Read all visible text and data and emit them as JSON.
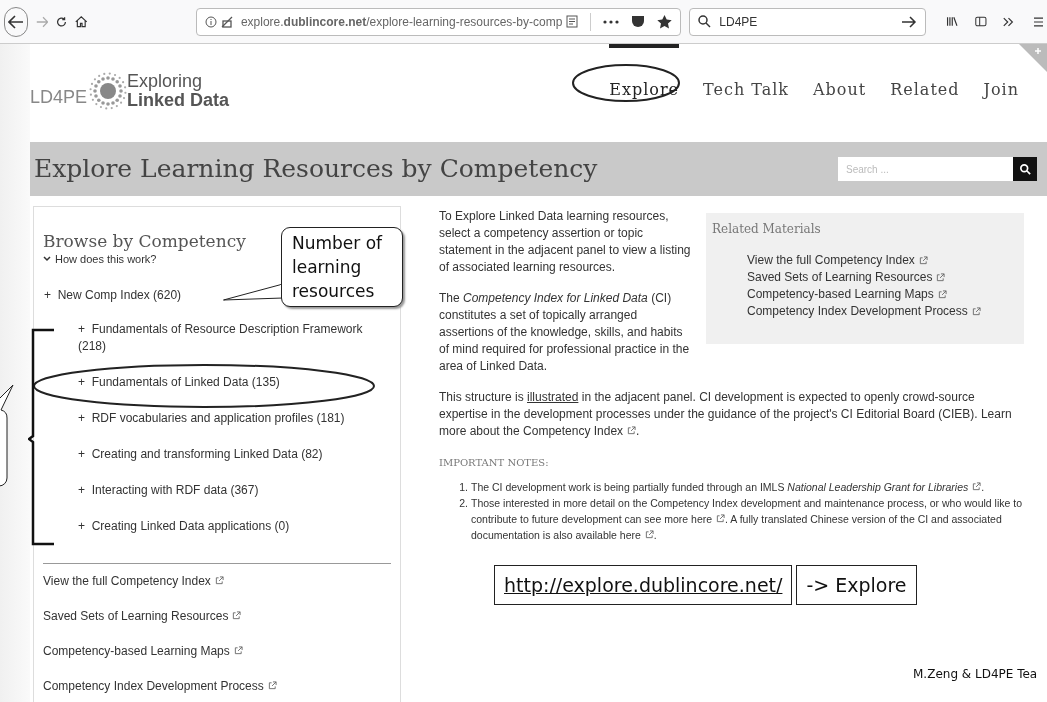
{
  "browser": {
    "url": "explore.**dublincore.net**/explore-learning-resources-by-comp",
    "search": "LD4PE"
  },
  "site": {
    "logo": "LD4PE",
    "brand": [
      "Exploring",
      "Linked Data"
    ],
    "nav": [
      {
        "label": "Explore",
        "selected": true
      },
      {
        "label": "Tech Talk",
        "selected": false
      },
      {
        "label": "About",
        "selected": false
      },
      {
        "label": "Related",
        "selected": false
      },
      {
        "label": "Join",
        "selected": false
      }
    ]
  },
  "page_title": "Explore Learning Resources by Competency",
  "search": {
    "placeholder": "Search ..."
  },
  "sidebar": {
    "heading": "Browse by Competency",
    "help": "How does this work?",
    "tree": [
      {
        "marker": "+",
        "label": "New Comp Index (620)",
        "children": [
          {
            "marker": "+",
            "label": "Fundamentals of Resource Description Framework (218)"
          },
          {
            "marker": "+",
            "label": "Fundamentals of Linked Data (135)"
          },
          {
            "marker": "+",
            "label": "RDF vocabularies and application profiles (181)"
          },
          {
            "marker": "+",
            "label": "Creating and transforming Linked Data (82)"
          },
          {
            "marker": "+",
            "label": "Interacting with RDF data (367)"
          },
          {
            "marker": "+",
            "label": "Creating Linked Data applications (0)"
          }
        ]
      }
    ],
    "links": [
      "View the full Competency Index",
      "Saved Sets of Learning Resources",
      "Competency-based Learning Maps",
      "Competency Index Development Process"
    ]
  },
  "related": {
    "heading": "Related Materials",
    "links": [
      "View the full Competency Index",
      "Saved Sets of Learning Resources",
      "Competency-based Learning Maps",
      "Competency Index Development Process"
    ]
  },
  "paragraphs": [
    [
      {
        "kind": "text",
        "text": "To Explore Linked Data learning resources, select a competency assertion or topic statement in the adjacent panel to view a listing of associated learning resources."
      }
    ],
    [
      {
        "kind": "text",
        "text": "The *Competency Index for Linked Data* (CI) constitutes a set of topically arranged assertions of the knowledge, skills, and habits of mind required for professional practice in the area of Linked Data."
      }
    ],
    [
      {
        "kind": "text",
        "text": "This structure is"
      },
      {
        "kind": "link",
        "text": "illustrated"
      },
      {
        "kind": "text",
        "text": "in the adjacent panel. CI development is expected to openly crowd-source expertise in the development processes under the guidance of the project's CI Editorial Board (CIEB). Learn more about the Competency Index",
        "external": true
      },
      {
        "kind": "text",
        "text": "."
      }
    ]
  ],
  "notes": {
    "heading": "IMPORTANT NOTES:",
    "items": [
      {
        "number": "1.",
        "segments": [
          {
            "text": "The CI development work is being partially funded through an IMLS *National Leadership Grant for Libraries*",
            "external": true
          },
          {
            "text": "."
          }
        ]
      },
      {
        "number": "2.",
        "segments": [
          {
            "text": "Those interested in more detail on the Competency Index development and maintenance process, or who would like to contribute to future development can see more here",
            "external": true
          },
          {
            "text": ". A fully translated Chinese version of the CI and associated documentation is also available here",
            "external": true
          },
          {
            "text": "."
          }
        ]
      }
    ]
  },
  "annotations": {
    "callout": "Number of learning resources",
    "url": "http://explore.dublincore.net/",
    "action": "-> Explore",
    "credit": "M.Zeng & LD4PE Tea"
  }
}
